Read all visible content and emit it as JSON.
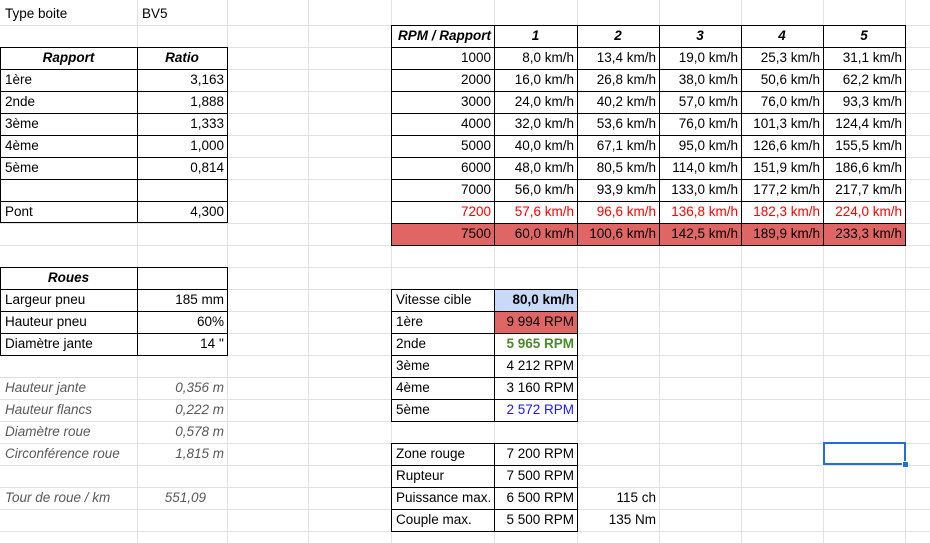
{
  "type_boite": {
    "label": "Type boite",
    "value": "BV5"
  },
  "rapport_table": {
    "headers": [
      "Rapport",
      "Ratio"
    ],
    "rows": [
      [
        "1ère",
        "3,163"
      ],
      [
        "2nde",
        "1,888"
      ],
      [
        "3ème",
        "1,333"
      ],
      [
        "4ème",
        "1,000"
      ],
      [
        "5ème",
        "0,814"
      ]
    ],
    "pont": {
      "label": "Pont",
      "value": "4,300"
    }
  },
  "roues": {
    "header": "Roues",
    "rows": [
      [
        "Largeur pneu",
        "185 mm"
      ],
      [
        "Hauteur pneu",
        "60%"
      ],
      [
        "Diamètre jante",
        "14 ''"
      ]
    ]
  },
  "computed": [
    [
      "Hauteur jante",
      "0,356 m"
    ],
    [
      "Hauteur flancs",
      "0,222 m"
    ],
    [
      "Diamètre roue",
      "0,578 m"
    ],
    [
      "Circonférence roue",
      "1,815 m"
    ]
  ],
  "tour_roue": {
    "label": "Tour de roue / km",
    "value": "551,09"
  },
  "rpm_table": {
    "header": "RPM / Rapport",
    "gears": [
      "1",
      "2",
      "3",
      "4",
      "5"
    ],
    "rows": [
      {
        "rpm": "1000",
        "speeds": [
          "8,0 km/h",
          "13,4 km/h",
          "19,0 km/h",
          "25,3 km/h",
          "31,1 km/h"
        ]
      },
      {
        "rpm": "2000",
        "speeds": [
          "16,0 km/h",
          "26,8 km/h",
          "38,0 km/h",
          "50,6 km/h",
          "62,2 km/h"
        ]
      },
      {
        "rpm": "3000",
        "speeds": [
          "24,0 km/h",
          "40,2 km/h",
          "57,0 km/h",
          "76,0 km/h",
          "93,3 km/h"
        ]
      },
      {
        "rpm": "4000",
        "speeds": [
          "32,0 km/h",
          "53,6 km/h",
          "76,0 km/h",
          "101,3 km/h",
          "124,4 km/h"
        ]
      },
      {
        "rpm": "5000",
        "speeds": [
          "40,0 km/h",
          "67,1 km/h",
          "95,0 km/h",
          "126,6 km/h",
          "155,5 km/h"
        ]
      },
      {
        "rpm": "6000",
        "speeds": [
          "48,0 km/h",
          "80,5 km/h",
          "114,0 km/h",
          "151,9 km/h",
          "186,6 km/h"
        ]
      },
      {
        "rpm": "7000",
        "speeds": [
          "56,0 km/h",
          "93,9 km/h",
          "133,0 km/h",
          "177,2 km/h",
          "217,7 km/h"
        ]
      },
      {
        "rpm": "7200",
        "speeds": [
          "57,6 km/h",
          "96,6 km/h",
          "136,8 km/h",
          "182,3 km/h",
          "224,0 km/h"
        ]
      },
      {
        "rpm": "7500",
        "speeds": [
          "60,0 km/h",
          "100,6 km/h",
          "142,5 km/h",
          "189,9 km/h",
          "233,3 km/h"
        ]
      }
    ]
  },
  "vitesse": {
    "label": "Vitesse cible",
    "value": "80,0 km/h",
    "rows": [
      [
        "1ère",
        "9 994 RPM"
      ],
      [
        "2nde",
        "5 965 RPM"
      ],
      [
        "3ème",
        "4 212 RPM"
      ],
      [
        "4ème",
        "3 160 RPM"
      ],
      [
        "5ème",
        "2 572 RPM"
      ]
    ]
  },
  "engine": {
    "rows": [
      [
        "Zone rouge",
        "7 200 RPM"
      ],
      [
        "Rupteur",
        "7 500 RPM"
      ],
      [
        "Puissance max.",
        "6 500 RPM"
      ],
      [
        "Couple max.",
        "5 500 RPM"
      ]
    ],
    "puissance_value": "115 ch",
    "couple_value": "135 Nm"
  },
  "colors": {
    "redline": "#ff0000",
    "rupteur_fill": "#e06666",
    "target_fill": "#c9daf8",
    "green_text": "#4a8a2a",
    "blue_text": "#1a1aff",
    "selection": "#1e6fd9"
  }
}
